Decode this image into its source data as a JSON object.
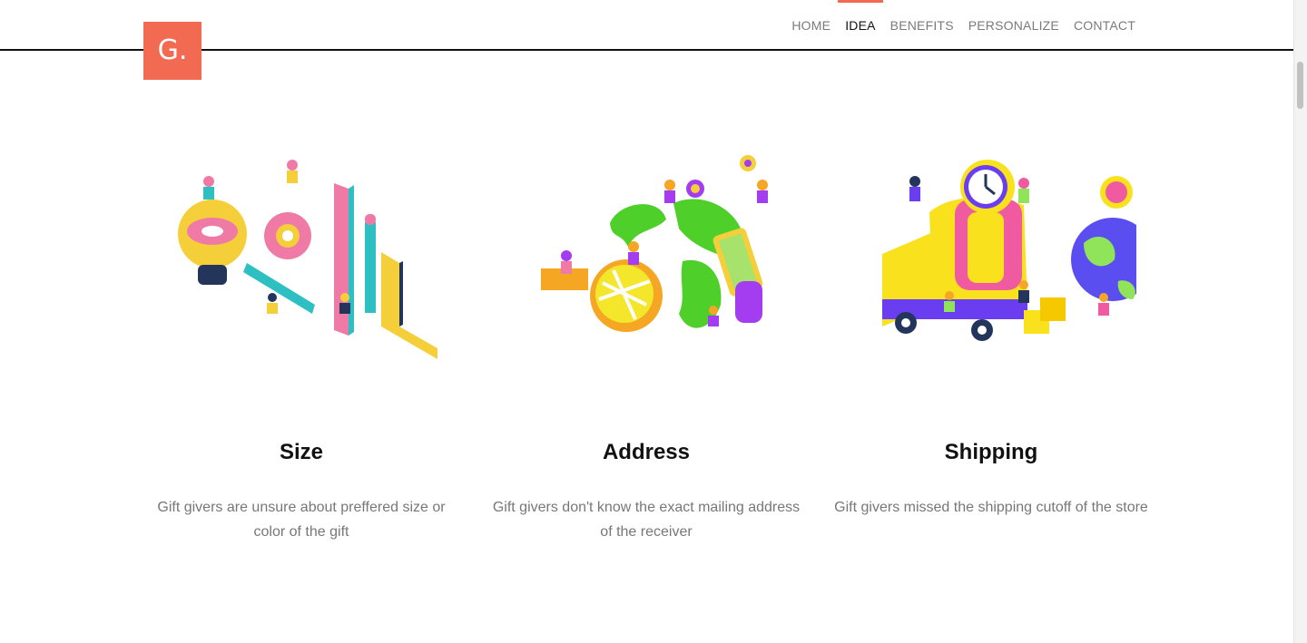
{
  "logo": {
    "text": "G."
  },
  "nav": {
    "items": [
      {
        "label": "HOME",
        "active": false
      },
      {
        "label": "IDEA",
        "active": true
      },
      {
        "label": "BENEFITS",
        "active": false
      },
      {
        "label": "PERSONALIZE",
        "active": false
      },
      {
        "label": "CONTACT",
        "active": false
      }
    ]
  },
  "colors": {
    "accent": "#f26a52"
  },
  "features": [
    {
      "title": "Size",
      "description": "Gift givers are unsure about preffered size or color of the gift",
      "icon": "measuring-tools-illustration"
    },
    {
      "title": "Address",
      "description": "Gift givers don't know the exact mailing address of the receiver",
      "icon": "globe-map-illustration"
    },
    {
      "title": "Shipping",
      "description": "Gift givers missed the shipping cutoff of the store",
      "icon": "delivery-truck-illustration"
    }
  ]
}
